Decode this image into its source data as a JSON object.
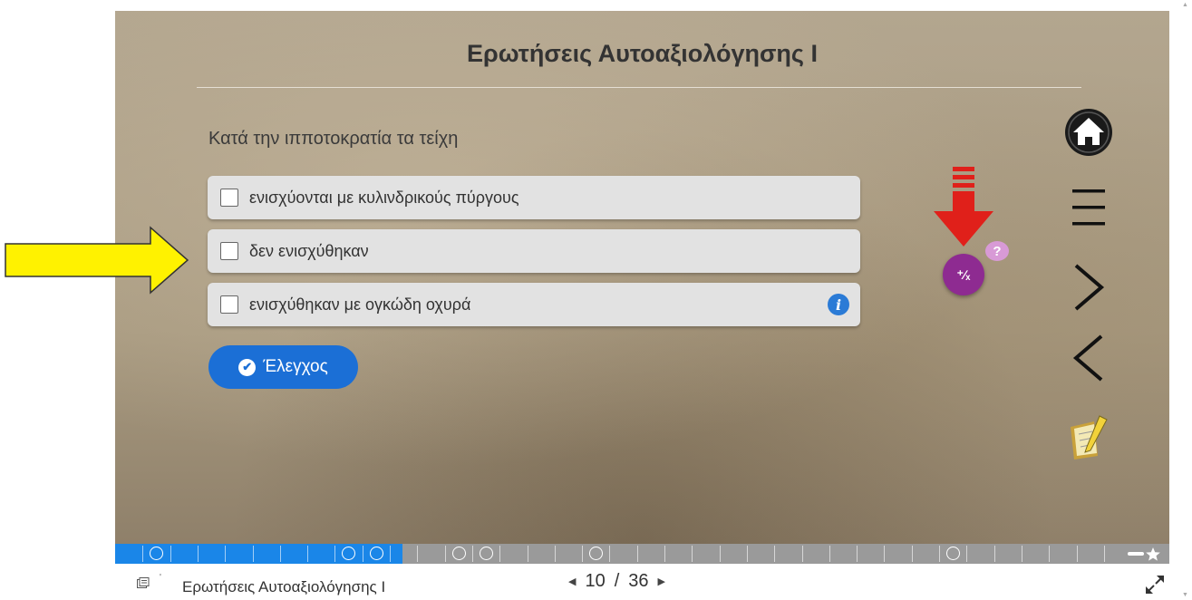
{
  "slide": {
    "title": "Ερωτήσεις Αυτοαξιολόγησης Ι",
    "question": "Κατά την ιπποτοκρατία τα τείχη",
    "options": [
      {
        "label": "ενισχύονται με κυλινδρικούς πύργους",
        "checked": false
      },
      {
        "label": "δεν ενισχύθηκαν",
        "checked": false
      },
      {
        "label": "ενισχύθηκαν με ογκώδη οχυρά",
        "checked": false,
        "has_info": true
      }
    ],
    "check_button": {
      "label": "Έλεγχος",
      "icon": "check-circle-icon"
    },
    "hint_button": {
      "symbol": "⁺∕ₓ",
      "badge": "?"
    },
    "accent_colors": {
      "check_button": "#1b6fd6",
      "hint_button": "#8e2b91",
      "info_icon": "#2b7bd6",
      "annotation_arrow": "#e0201a",
      "pointer_arrow": "#fff200"
    }
  },
  "side_nav": [
    "home-icon",
    "menu-icon",
    "next-arrow-icon",
    "prev-arrow-icon",
    "notes-icon"
  ],
  "progress": {
    "current": 10,
    "total": 36,
    "fill_fraction": 0.273
  },
  "footer": {
    "title": "Ερωτήσεις Αυτοαξιολόγησης Ι",
    "current_page": "10",
    "separator": "/",
    "total_pages": "36",
    "prev_symbol": "◀",
    "next_symbol": "▶"
  }
}
